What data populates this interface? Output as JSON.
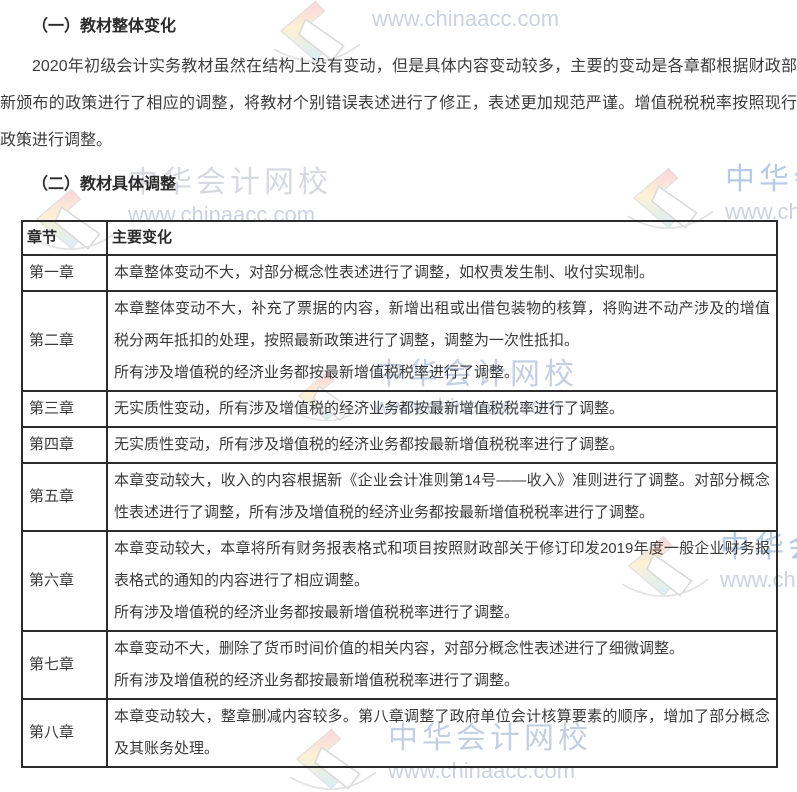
{
  "watermark": {
    "brand": "中华会计网校",
    "url": "www.chinaacc.com"
  },
  "page": {
    "heading1": "（一）教材整体变化",
    "paragraph": "2020年初级会计实务教材虽然在结构上没有变动，但是具体内容变动较多，主要的变动是各章都根据财政部新颁布的政策进行了相应的调整，将教材个别错误表述进行了修正，表述更加规范严谨。增值税税税率按照现行政策进行调整。",
    "heading2": "（二）教材具体调整"
  },
  "table": {
    "headers": [
      "章节",
      "主要变化"
    ],
    "rows": [
      {
        "chapter": "第一章",
        "change": "本章整体变动不大，对部分概念性表述进行了调整，如权责发生制、收付实现制。"
      },
      {
        "chapter": "第二章",
        "change": "本章整体变动不大，补充了票据的内容，新增出租或出借包装物的核算，将购进不动产涉及的增值税分两年抵扣的处理，按照最新政策进行了调整，调整为一次性抵扣。\n所有涉及增值税的经济业务都按最新增值税税率进行了调整。"
      },
      {
        "chapter": "第三章",
        "change": "无实质性变动，所有涉及增值税的经济业务都按最新增值税税率进行了调整。"
      },
      {
        "chapter": "第四章",
        "change": "无实质性变动，所有涉及增值税的经济业务都按最新增值税税率进行了调整。"
      },
      {
        "chapter": "第五章",
        "change": "本章变动较大，收入的内容根据新《企业会计准则第14号——收入》准则进行了调整。对部分概念性表述进行了调整，所有涉及增值税的经济业务都按最新增值税税率进行了调整。"
      },
      {
        "chapter": "第六章",
        "change": "本章变动较大，本章将所有财务报表格式和项目按照财政部关于修订印发2019年度一般企业财务报表格式的通知的内容进行了相应调整。\n所有涉及增值税的经济业务都按最新增值税税率进行了调整。"
      },
      {
        "chapter": "第七章",
        "change": "本章变动不大，删除了货币时间价值的相关内容，对部分概念性表述进行了细微调整。\n所有涉及增值税的经济业务都按最新增值税税率进行了调整。"
      },
      {
        "chapter": "第八章",
        "change": "本章变动较大，整章删减内容较多。第八章调整了政府单位会计核算要素的顺序，增加了部分概念及其账务处理。"
      }
    ]
  },
  "colors": {
    "border": "#2b2b2b",
    "text": "#3a3a3a",
    "watermark_brand": "#b9c7dd",
    "watermark_url": "#c6cedf",
    "logo_pink": "#f5b8c8",
    "logo_yellow": "#fce9b8",
    "logo_blue": "#bfe3f2"
  }
}
